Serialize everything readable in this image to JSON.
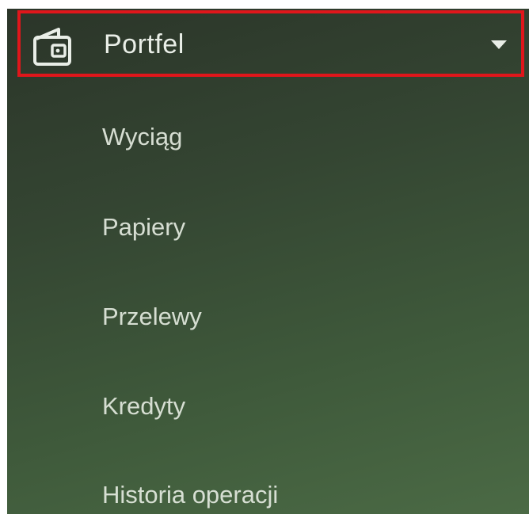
{
  "menu": {
    "header": {
      "label": "Portfel",
      "icon": "wallet-icon",
      "caret_icon": "caret-down-icon",
      "highlight_color": "#e0161b"
    },
    "items": [
      {
        "label": "Wyciąg"
      },
      {
        "label": "Papiery"
      },
      {
        "label": "Przelewy"
      },
      {
        "label": "Kredyty"
      },
      {
        "label": "Historia operacji"
      }
    ]
  }
}
